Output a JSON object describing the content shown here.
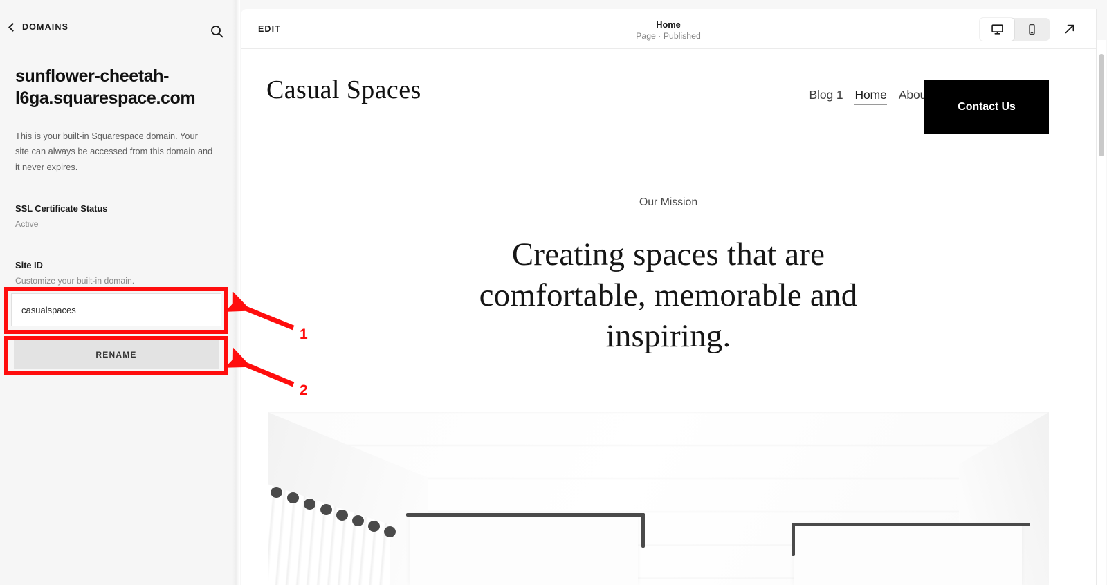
{
  "sidebar": {
    "back_label": "DOMAINS",
    "search_icon": "search-icon",
    "domain_title": "sunflower-cheetah-l6ga.squarespace.com",
    "domain_description": "This is your built-in Squarespace domain. Your site can always be accessed from this domain and it never expires.",
    "ssl": {
      "label": "SSL Certificate Status",
      "value": "Active"
    },
    "site_id": {
      "label": "Site ID",
      "sublabel": "Customize your built-in domain.",
      "input_value": "casualspaces",
      "input_placeholder": "Site ID",
      "rename_button": "RENAME"
    }
  },
  "annotations": {
    "accent_color": "#ff0d0d",
    "markers": [
      {
        "number": "1",
        "target": "site-id-input"
      },
      {
        "number": "2",
        "target": "rename-button"
      }
    ]
  },
  "toolbar": {
    "edit_label": "EDIT",
    "page_title": "Home",
    "page_status": "Page · Published",
    "devices": [
      {
        "name": "desktop",
        "icon": "desktop-icon",
        "active": true
      },
      {
        "name": "mobile",
        "icon": "mobile-icon",
        "active": false
      }
    ],
    "external_link_icon": "external-link-arrow-icon"
  },
  "site": {
    "brand": "Casual Spaces",
    "nav": [
      {
        "label": "Blog 1",
        "active": false
      },
      {
        "label": "Home",
        "active": true
      },
      {
        "label": "About",
        "active": false
      }
    ],
    "cta_label": "Contact Us",
    "eyebrow": "Our Mission",
    "headline": "Creating spaces that are comfortable, memorable and inspiring.",
    "hero_image_alt": "White shiplap ceiling with white curtains on a dark rod"
  }
}
